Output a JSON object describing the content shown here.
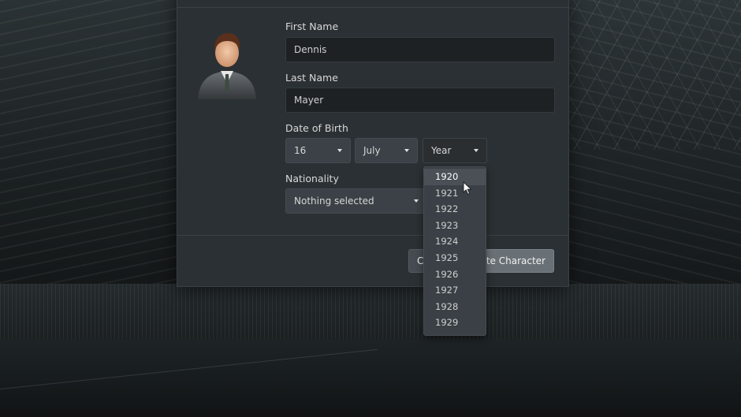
{
  "form": {
    "first_name_label": "First Name",
    "first_name_value": "Dennis",
    "last_name_label": "Last Name",
    "last_name_value": "Mayer",
    "dob_label": "Date of Birth",
    "dob_day": "16",
    "dob_month": "July",
    "dob_year": "Year",
    "nationality_label": "Nationality",
    "nationality_value": "Nothing selected"
  },
  "buttons": {
    "cancel_label": "C",
    "create_label": "te Character"
  },
  "year_dropdown": {
    "options": [
      "1920",
      "1921",
      "1922",
      "1923",
      "1924",
      "1925",
      "1926",
      "1927",
      "1928",
      "1929"
    ],
    "hovered_index": 0
  },
  "icons": {
    "avatar": "businessman-avatar-icon",
    "caret": "chevron-down-icon",
    "cursor": "mouse-pointer-icon"
  }
}
